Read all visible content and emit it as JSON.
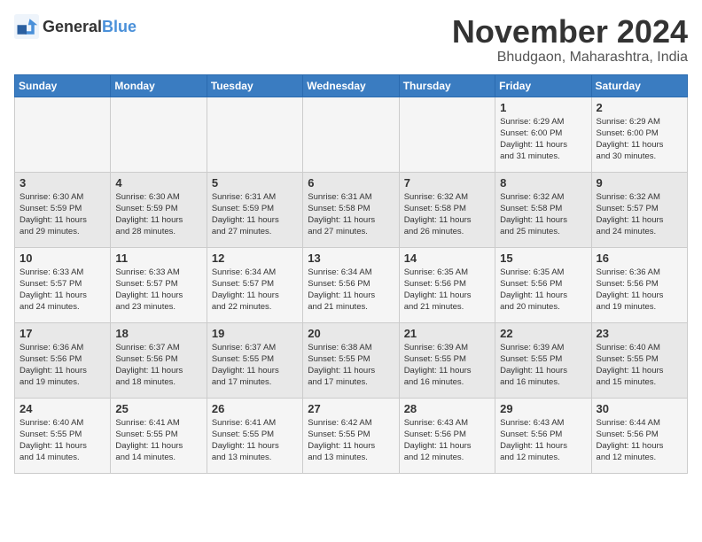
{
  "logo": {
    "general": "General",
    "blue": "Blue"
  },
  "title": {
    "month_year": "November 2024",
    "location": "Bhudgaon, Maharashtra, India"
  },
  "header_days": [
    "Sunday",
    "Monday",
    "Tuesday",
    "Wednesday",
    "Thursday",
    "Friday",
    "Saturday"
  ],
  "weeks": [
    [
      {
        "day": "",
        "info": ""
      },
      {
        "day": "",
        "info": ""
      },
      {
        "day": "",
        "info": ""
      },
      {
        "day": "",
        "info": ""
      },
      {
        "day": "",
        "info": ""
      },
      {
        "day": "1",
        "info": "Sunrise: 6:29 AM\nSunset: 6:00 PM\nDaylight: 11 hours\nand 31 minutes."
      },
      {
        "day": "2",
        "info": "Sunrise: 6:29 AM\nSunset: 6:00 PM\nDaylight: 11 hours\nand 30 minutes."
      }
    ],
    [
      {
        "day": "3",
        "info": "Sunrise: 6:30 AM\nSunset: 5:59 PM\nDaylight: 11 hours\nand 29 minutes."
      },
      {
        "day": "4",
        "info": "Sunrise: 6:30 AM\nSunset: 5:59 PM\nDaylight: 11 hours\nand 28 minutes."
      },
      {
        "day": "5",
        "info": "Sunrise: 6:31 AM\nSunset: 5:59 PM\nDaylight: 11 hours\nand 27 minutes."
      },
      {
        "day": "6",
        "info": "Sunrise: 6:31 AM\nSunset: 5:58 PM\nDaylight: 11 hours\nand 27 minutes."
      },
      {
        "day": "7",
        "info": "Sunrise: 6:32 AM\nSunset: 5:58 PM\nDaylight: 11 hours\nand 26 minutes."
      },
      {
        "day": "8",
        "info": "Sunrise: 6:32 AM\nSunset: 5:58 PM\nDaylight: 11 hours\nand 25 minutes."
      },
      {
        "day": "9",
        "info": "Sunrise: 6:32 AM\nSunset: 5:57 PM\nDaylight: 11 hours\nand 24 minutes."
      }
    ],
    [
      {
        "day": "10",
        "info": "Sunrise: 6:33 AM\nSunset: 5:57 PM\nDaylight: 11 hours\nand 24 minutes."
      },
      {
        "day": "11",
        "info": "Sunrise: 6:33 AM\nSunset: 5:57 PM\nDaylight: 11 hours\nand 23 minutes."
      },
      {
        "day": "12",
        "info": "Sunrise: 6:34 AM\nSunset: 5:57 PM\nDaylight: 11 hours\nand 22 minutes."
      },
      {
        "day": "13",
        "info": "Sunrise: 6:34 AM\nSunset: 5:56 PM\nDaylight: 11 hours\nand 21 minutes."
      },
      {
        "day": "14",
        "info": "Sunrise: 6:35 AM\nSunset: 5:56 PM\nDaylight: 11 hours\nand 21 minutes."
      },
      {
        "day": "15",
        "info": "Sunrise: 6:35 AM\nSunset: 5:56 PM\nDaylight: 11 hours\nand 20 minutes."
      },
      {
        "day": "16",
        "info": "Sunrise: 6:36 AM\nSunset: 5:56 PM\nDaylight: 11 hours\nand 19 minutes."
      }
    ],
    [
      {
        "day": "17",
        "info": "Sunrise: 6:36 AM\nSunset: 5:56 PM\nDaylight: 11 hours\nand 19 minutes."
      },
      {
        "day": "18",
        "info": "Sunrise: 6:37 AM\nSunset: 5:56 PM\nDaylight: 11 hours\nand 18 minutes."
      },
      {
        "day": "19",
        "info": "Sunrise: 6:37 AM\nSunset: 5:55 PM\nDaylight: 11 hours\nand 17 minutes."
      },
      {
        "day": "20",
        "info": "Sunrise: 6:38 AM\nSunset: 5:55 PM\nDaylight: 11 hours\nand 17 minutes."
      },
      {
        "day": "21",
        "info": "Sunrise: 6:39 AM\nSunset: 5:55 PM\nDaylight: 11 hours\nand 16 minutes."
      },
      {
        "day": "22",
        "info": "Sunrise: 6:39 AM\nSunset: 5:55 PM\nDaylight: 11 hours\nand 16 minutes."
      },
      {
        "day": "23",
        "info": "Sunrise: 6:40 AM\nSunset: 5:55 PM\nDaylight: 11 hours\nand 15 minutes."
      }
    ],
    [
      {
        "day": "24",
        "info": "Sunrise: 6:40 AM\nSunset: 5:55 PM\nDaylight: 11 hours\nand 14 minutes."
      },
      {
        "day": "25",
        "info": "Sunrise: 6:41 AM\nSunset: 5:55 PM\nDaylight: 11 hours\nand 14 minutes."
      },
      {
        "day": "26",
        "info": "Sunrise: 6:41 AM\nSunset: 5:55 PM\nDaylight: 11 hours\nand 13 minutes."
      },
      {
        "day": "27",
        "info": "Sunrise: 6:42 AM\nSunset: 5:55 PM\nDaylight: 11 hours\nand 13 minutes."
      },
      {
        "day": "28",
        "info": "Sunrise: 6:43 AM\nSunset: 5:56 PM\nDaylight: 11 hours\nand 12 minutes."
      },
      {
        "day": "29",
        "info": "Sunrise: 6:43 AM\nSunset: 5:56 PM\nDaylight: 11 hours\nand 12 minutes."
      },
      {
        "day": "30",
        "info": "Sunrise: 6:44 AM\nSunset: 5:56 PM\nDaylight: 11 hours\nand 12 minutes."
      }
    ]
  ]
}
